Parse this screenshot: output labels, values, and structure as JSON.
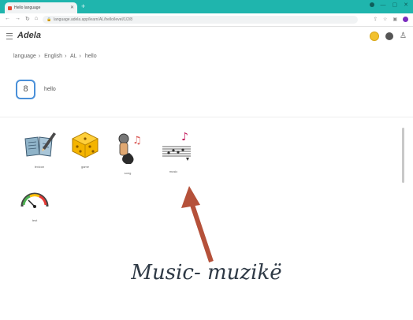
{
  "browser": {
    "tab_title": "Hello language",
    "url": "language.adela.app/learn/AL/hello/level/1/2/8",
    "new_tab_icon": "plus-icon"
  },
  "app": {
    "logo": "Adela",
    "breadcrumb": [
      "language",
      "English",
      "AL",
      "hello"
    ],
    "level": "8",
    "word_title": "hello",
    "coin_color": "#f2c12e",
    "accent": "#4a90d9"
  },
  "cards": [
    {
      "label": "lexicon",
      "icon": "book-pencil-icon"
    },
    {
      "label": "game",
      "icon": "dice-icon"
    },
    {
      "label": "song",
      "icon": "microphone-music-icon"
    },
    {
      "label": "music",
      "icon": "music-staff-icon"
    },
    {
      "label": "test",
      "icon": "gauge-icon"
    }
  ],
  "annotation": {
    "caption": "Music- muzikë",
    "arrow_color": "#b5513a"
  }
}
